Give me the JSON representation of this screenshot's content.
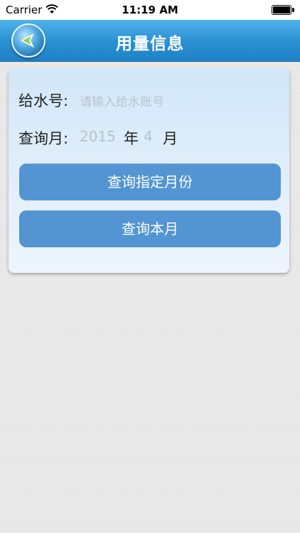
{
  "status_bar": {
    "carrier": "Carrier",
    "time": "11:19 AM"
  },
  "nav": {
    "title": "用量信息"
  },
  "form": {
    "account_label": "给水号:",
    "account_placeholder": "请输入给水账号",
    "month_label": "查询月:",
    "year_value": "2015",
    "year_unit": "年",
    "month_value": "4",
    "month_unit": "月"
  },
  "buttons": {
    "query_month": "查询指定月份",
    "query_current": "查询本月"
  },
  "colors": {
    "nav": "#2a8fd2",
    "button": "#5295d2",
    "card": "#e6f1fb"
  }
}
